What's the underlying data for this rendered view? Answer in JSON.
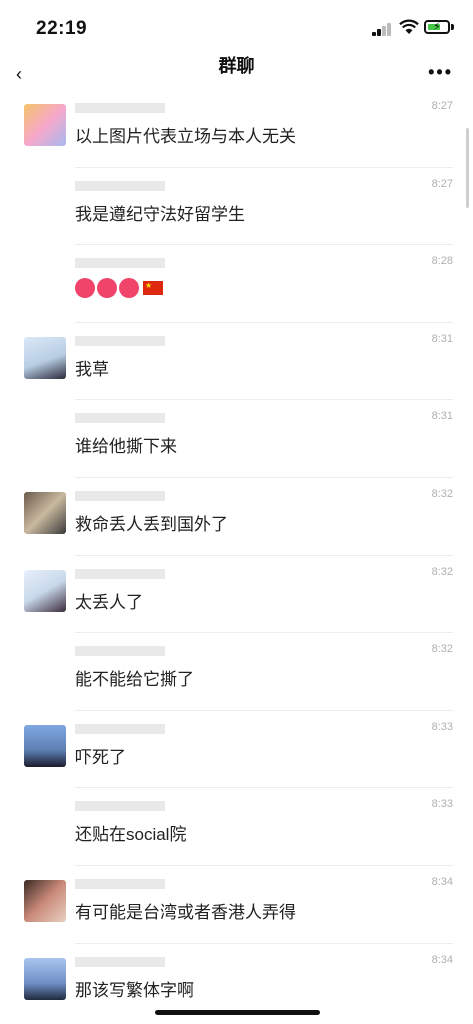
{
  "status": {
    "time": "22:19"
  },
  "nav": {
    "title": "群聊",
    "back_icon": "‹",
    "more_icon": "•••"
  },
  "messages": [
    {
      "text": "以上图片代表立场与本人无关",
      "time": "8:27",
      "avatar_color": "#f5c78a"
    },
    {
      "text": "我是遵纪守法好留学生",
      "time": "8:27",
      "avatar_color": ""
    },
    {
      "text": "",
      "time": "8:28",
      "avatar_color": "",
      "emoji": "hearts-flag"
    },
    {
      "text": "我草",
      "time": "8:31",
      "avatar_color": "#cfe3f7"
    },
    {
      "text": "谁给他撕下来",
      "time": "8:31",
      "avatar_color": ""
    },
    {
      "text": "救命丢人丢到国外了",
      "time": "8:32",
      "avatar_color": "#8b7a6a"
    },
    {
      "text": "太丢人了",
      "time": "8:32",
      "avatar_color": "#d9e7f4"
    },
    {
      "text": "能不能给它撕了",
      "time": "8:32",
      "avatar_color": ""
    },
    {
      "text": "吓死了",
      "time": "8:33",
      "avatar_color": "#5c7fb3"
    },
    {
      "text": "还贴在social院",
      "time": "8:33",
      "avatar_color": ""
    },
    {
      "text": "有可能是台湾或者香港人弄得",
      "time": "8:34",
      "avatar_color": "#7a4b3a"
    },
    {
      "text": "那该写繁体字啊",
      "time": "8:34",
      "avatar_color": "#6f8fc6"
    }
  ]
}
